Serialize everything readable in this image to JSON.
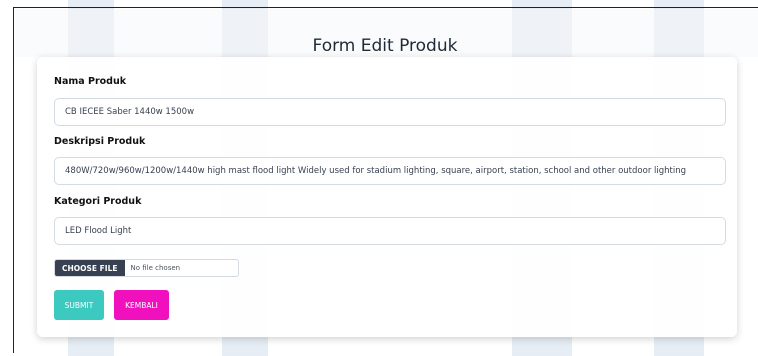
{
  "page_title": "Form Edit Produk",
  "form": {
    "fields": [
      {
        "label": "Nama Produk",
        "value": "CB IECEE Saber 1440w 1500w"
      },
      {
        "label": "Deskripsi Produk",
        "value": "480W/720w/960w/1200w/1440w high mast flood light Widely used for stadium lighting, square, airport, station, school and other outdoor lighting"
      },
      {
        "label": "Kategori Produk",
        "value": "LED Flood Light"
      }
    ],
    "file": {
      "button_label": "CHOOSE FILE",
      "status": "No file chosen"
    },
    "submit_label": "SUBMIT",
    "back_label": "KEMBALI"
  },
  "colors": {
    "submit": "#3cc9c0",
    "back": "#f010be",
    "file_button": "#374151"
  }
}
